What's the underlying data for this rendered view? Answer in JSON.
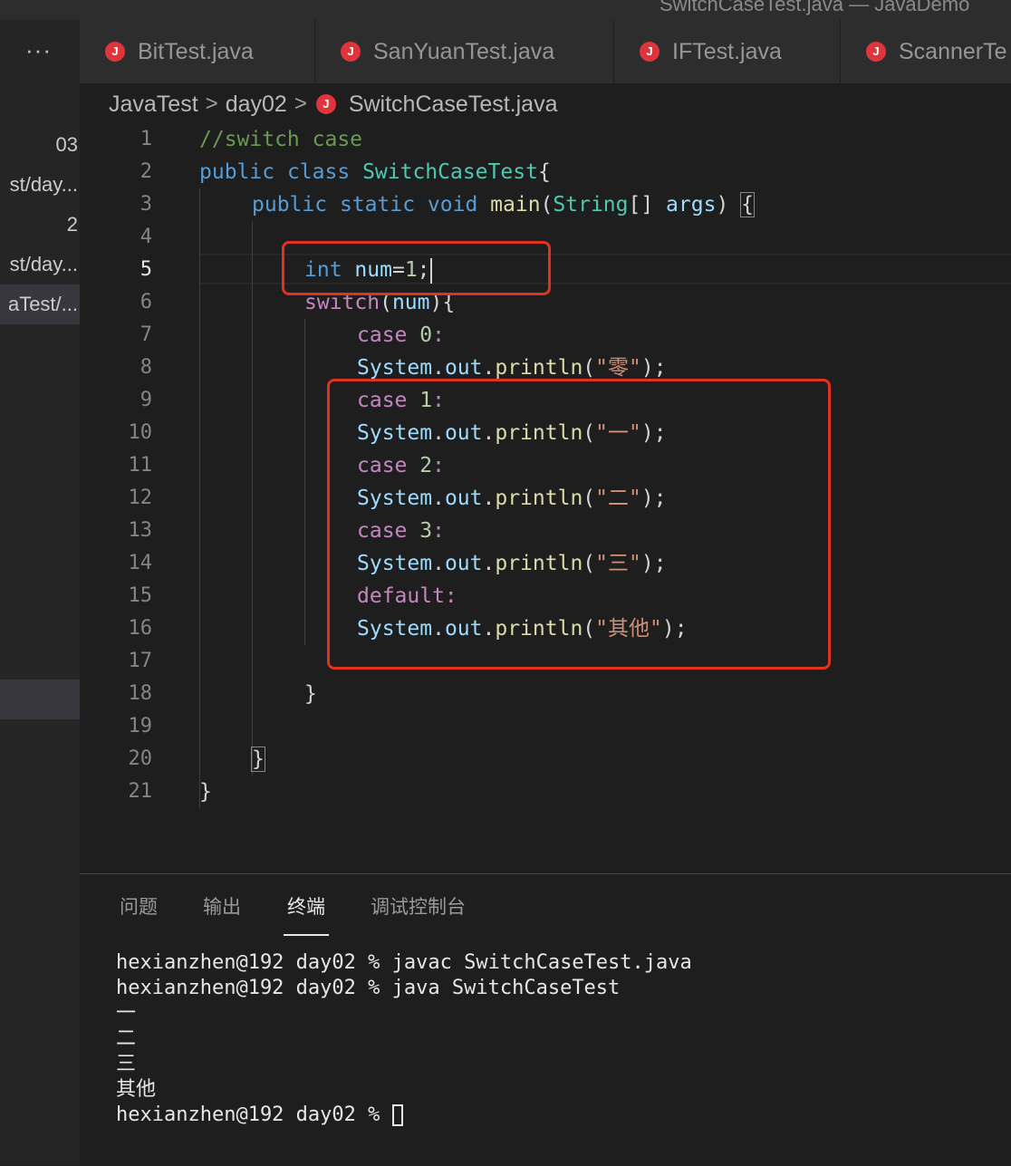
{
  "window": {
    "title": "SwitchCaseTest.java — JavaDemo"
  },
  "sidebar": {
    "more": "···",
    "items": [
      {
        "label": "03"
      },
      {
        "label": "st/day..."
      },
      {
        "label": "2"
      },
      {
        "label": "st/day..."
      },
      {
        "label": "aTest/..."
      }
    ]
  },
  "tabs": [
    {
      "label": "BitTest.java",
      "icon": "java-file-icon"
    },
    {
      "label": "SanYuanTest.java",
      "icon": "java-file-icon"
    },
    {
      "label": "IFTest.java",
      "icon": "java-file-icon"
    },
    {
      "label": "ScannerTe",
      "icon": "java-file-icon"
    }
  ],
  "breadcrumb": {
    "parts": [
      "JavaTest",
      "day02",
      "SwitchCaseTest.java"
    ],
    "sep": ">"
  },
  "editor": {
    "current_line": 5,
    "lines": [
      {
        "n": "1",
        "indent": 0,
        "tokens": [
          [
            "cmt",
            "//switch case"
          ]
        ]
      },
      {
        "n": "2",
        "indent": 0,
        "tokens": [
          [
            "kw",
            "public"
          ],
          [
            "pun",
            " "
          ],
          [
            "kw",
            "class"
          ],
          [
            "pun",
            " "
          ],
          [
            "cls",
            "SwitchCaseTest"
          ],
          [
            "pun",
            "{"
          ]
        ]
      },
      {
        "n": "3",
        "indent": 1,
        "tokens": [
          [
            "kw",
            "public"
          ],
          [
            "pun",
            " "
          ],
          [
            "kw",
            "static"
          ],
          [
            "pun",
            " "
          ],
          [
            "kw",
            "void"
          ],
          [
            "pun",
            " "
          ],
          [
            "fn",
            "main"
          ],
          [
            "pun",
            "("
          ],
          [
            "cls",
            "String"
          ],
          [
            "pun",
            "[] "
          ],
          [
            "var",
            "args"
          ],
          [
            "pun",
            ") "
          ],
          [
            "bracket",
            "{"
          ]
        ]
      },
      {
        "n": "4",
        "indent": 0,
        "tokens": []
      },
      {
        "n": "5",
        "indent": 2,
        "tokens": [
          [
            "kw",
            "int"
          ],
          [
            "pun",
            " "
          ],
          [
            "var",
            "num"
          ],
          [
            "pun",
            "="
          ],
          [
            "num",
            "1"
          ],
          [
            "pun",
            ";"
          ],
          [
            "cursor",
            ""
          ]
        ]
      },
      {
        "n": "6",
        "indent": 2,
        "tokens": [
          [
            "kw2",
            "switch"
          ],
          [
            "pun",
            "("
          ],
          [
            "var",
            "num"
          ],
          [
            "pun",
            "){"
          ]
        ]
      },
      {
        "n": "7",
        "indent": 3,
        "tokens": [
          [
            "kw2",
            "case"
          ],
          [
            "pun",
            " "
          ],
          [
            "num",
            "0"
          ],
          [
            "kw2",
            ":"
          ]
        ]
      },
      {
        "n": "8",
        "indent": 3,
        "tokens": [
          [
            "var",
            "System"
          ],
          [
            "pun",
            "."
          ],
          [
            "var",
            "out"
          ],
          [
            "pun",
            "."
          ],
          [
            "fn",
            "println"
          ],
          [
            "pun",
            "("
          ],
          [
            "str",
            "\"零\""
          ],
          [
            "pun",
            ");"
          ]
        ]
      },
      {
        "n": "9",
        "indent": 3,
        "tokens": [
          [
            "kw2",
            "case"
          ],
          [
            "pun",
            " "
          ],
          [
            "num",
            "1"
          ],
          [
            "kw2",
            ":"
          ]
        ]
      },
      {
        "n": "10",
        "indent": 3,
        "tokens": [
          [
            "var",
            "System"
          ],
          [
            "pun",
            "."
          ],
          [
            "var",
            "out"
          ],
          [
            "pun",
            "."
          ],
          [
            "fn",
            "println"
          ],
          [
            "pun",
            "("
          ],
          [
            "str",
            "\"一\""
          ],
          [
            "pun",
            ");"
          ]
        ]
      },
      {
        "n": "11",
        "indent": 3,
        "tokens": [
          [
            "kw2",
            "case"
          ],
          [
            "pun",
            " "
          ],
          [
            "num",
            "2"
          ],
          [
            "kw2",
            ":"
          ]
        ]
      },
      {
        "n": "12",
        "indent": 3,
        "tokens": [
          [
            "var",
            "System"
          ],
          [
            "pun",
            "."
          ],
          [
            "var",
            "out"
          ],
          [
            "pun",
            "."
          ],
          [
            "fn",
            "println"
          ],
          [
            "pun",
            "("
          ],
          [
            "str",
            "\"二\""
          ],
          [
            "pun",
            ");"
          ]
        ]
      },
      {
        "n": "13",
        "indent": 3,
        "tokens": [
          [
            "kw2",
            "case"
          ],
          [
            "pun",
            " "
          ],
          [
            "num",
            "3"
          ],
          [
            "kw2",
            ":"
          ]
        ]
      },
      {
        "n": "14",
        "indent": 3,
        "tokens": [
          [
            "var",
            "System"
          ],
          [
            "pun",
            "."
          ],
          [
            "var",
            "out"
          ],
          [
            "pun",
            "."
          ],
          [
            "fn",
            "println"
          ],
          [
            "pun",
            "("
          ],
          [
            "str",
            "\"三\""
          ],
          [
            "pun",
            ");"
          ]
        ]
      },
      {
        "n": "15",
        "indent": 3,
        "tokens": [
          [
            "kw2",
            "default:"
          ]
        ]
      },
      {
        "n": "16",
        "indent": 3,
        "tokens": [
          [
            "var",
            "System"
          ],
          [
            "pun",
            "."
          ],
          [
            "var",
            "out"
          ],
          [
            "pun",
            "."
          ],
          [
            "fn",
            "println"
          ],
          [
            "pun",
            "("
          ],
          [
            "str",
            "\"其他\""
          ],
          [
            "pun",
            ");"
          ]
        ]
      },
      {
        "n": "17",
        "indent": 0,
        "tokens": []
      },
      {
        "n": "18",
        "indent": 2,
        "tokens": [
          [
            "pun",
            "}"
          ]
        ]
      },
      {
        "n": "19",
        "indent": 0,
        "tokens": []
      },
      {
        "n": "20",
        "indent": 1,
        "tokens": [
          [
            "bracket",
            "}"
          ]
        ]
      },
      {
        "n": "21",
        "indent": 0,
        "tokens": [
          [
            "pun",
            "}"
          ]
        ]
      }
    ]
  },
  "panel": {
    "tabs": [
      {
        "label": "问题"
      },
      {
        "label": "输出"
      },
      {
        "label": "终端",
        "active": true
      },
      {
        "label": "调试控制台"
      }
    ],
    "terminal_lines": [
      "hexianzhen@192 day02 % javac SwitchCaseTest.java",
      "hexianzhen@192 day02 % java SwitchCaseTest",
      "一",
      "二",
      "三",
      "其他",
      "hexianzhen@192 day02 % "
    ]
  },
  "colors": {
    "annotation": "#e0331f",
    "java_icon": "#e0343c"
  }
}
